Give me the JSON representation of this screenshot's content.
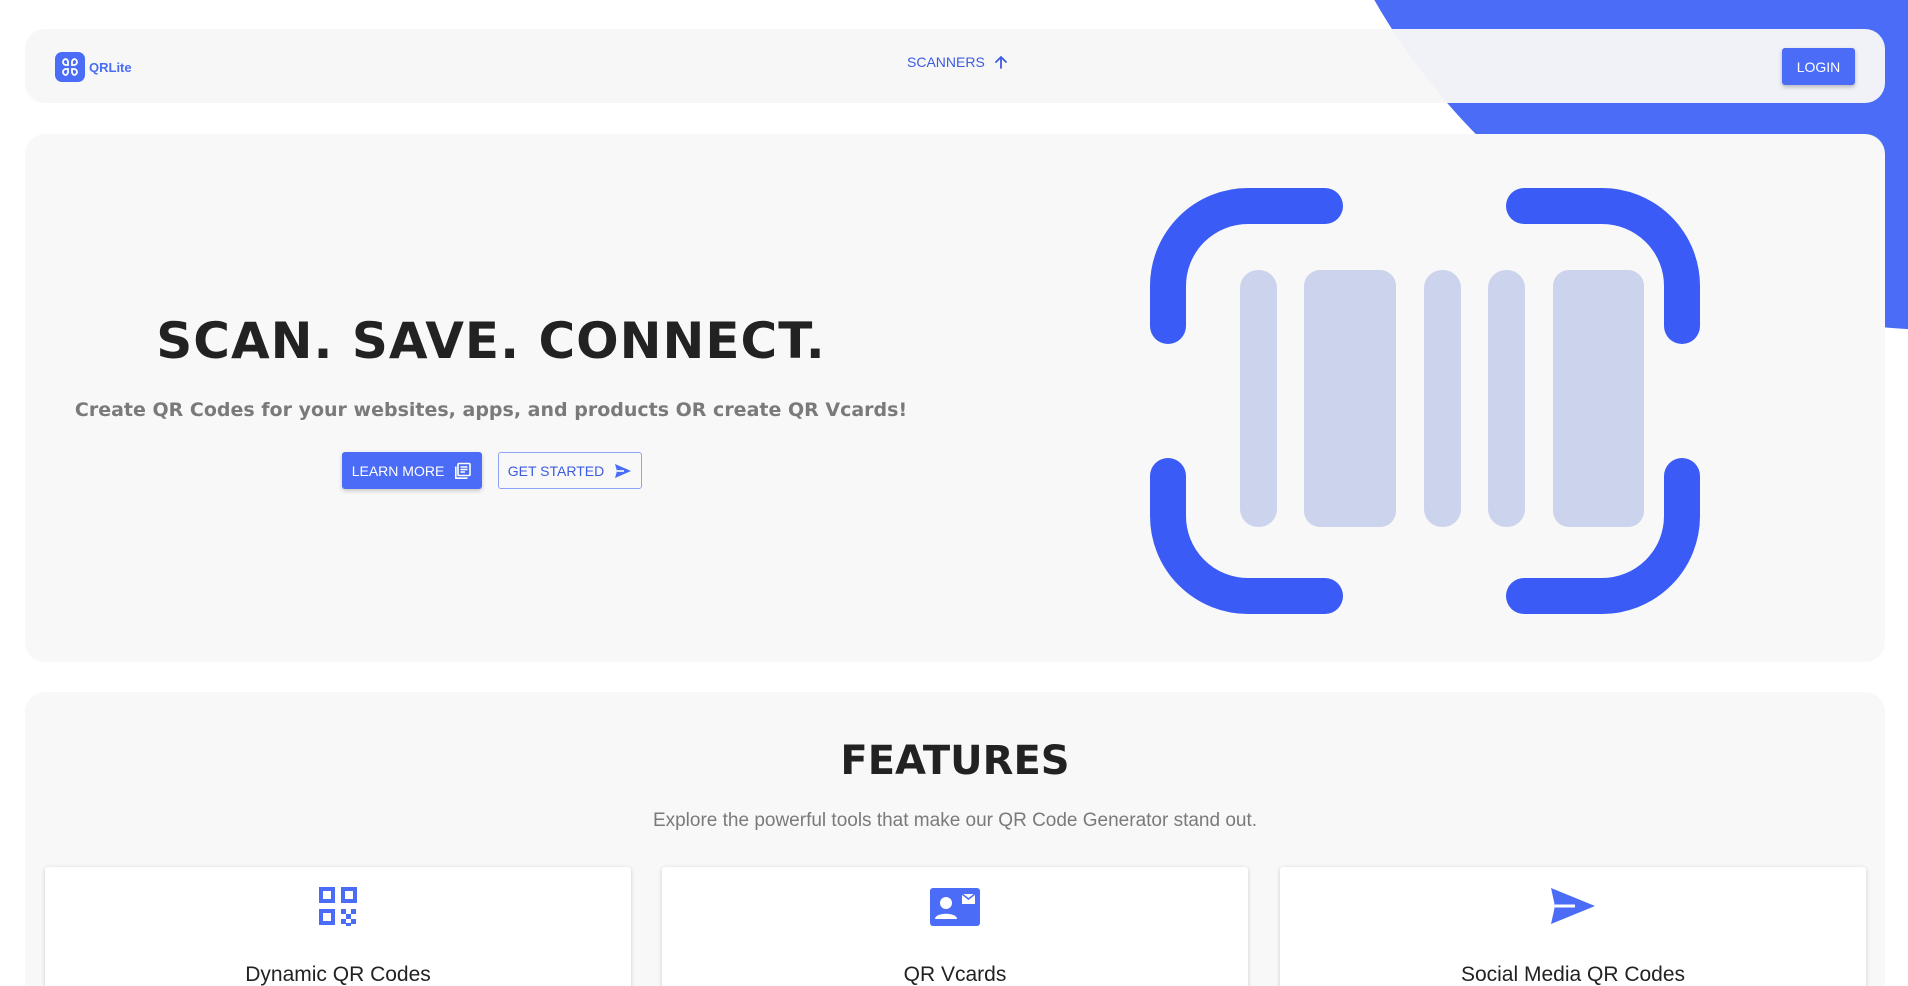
{
  "brand": {
    "name": "QRLite",
    "accent_color": "#4a6cf7"
  },
  "header": {
    "nav_scanners_label": "SCANNERS",
    "nav_scanners_icon": "arrow-up-icon",
    "login_label": "LOGIN"
  },
  "hero": {
    "title": "SCAN. SAVE. CONNECT.",
    "subtitle": "Create QR Codes for your websites, apps, and products OR create QR Vcards!",
    "learn_more_label": "LEARN MORE",
    "learn_more_icon": "article-icon",
    "get_started_label": "GET STARTED",
    "get_started_icon": "send-icon",
    "illustration": "barcode-scanner-illustration"
  },
  "features": {
    "title": "FEATURES",
    "subtitle": "Explore the powerful tools that make our QR Code Generator stand out.",
    "cards": [
      {
        "title": "Dynamic QR Codes",
        "icon": "qr-code-icon"
      },
      {
        "title": "QR Vcards",
        "icon": "contact-mail-icon"
      },
      {
        "title": "Social Media QR Codes",
        "icon": "send-icon"
      }
    ]
  }
}
